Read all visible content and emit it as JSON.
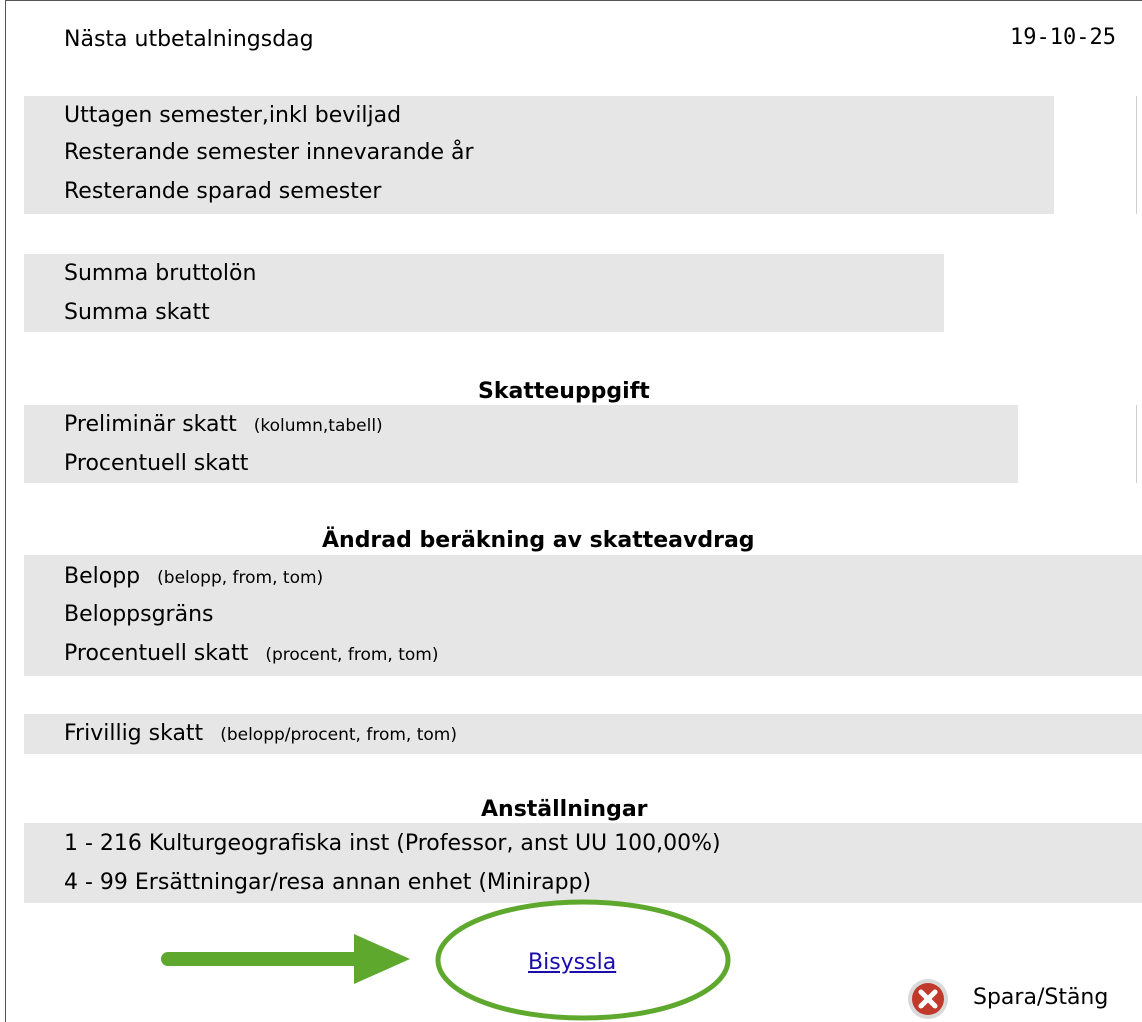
{
  "header": {
    "next_payday_label": "Nästa utbetalningsdag",
    "next_payday_value": "19-10-25"
  },
  "vacation": {
    "rows": [
      "Uttagen semester,inkl beviljad",
      "Resterande semester innevarande år",
      "Resterande sparad semester"
    ]
  },
  "totals": {
    "rows": [
      "Summa bruttolön",
      "Summa skatt"
    ]
  },
  "tax_info": {
    "title": "Skatteuppgift",
    "prelim_label": "Preliminär skatt",
    "prelim_hint": "(kolumn,tabell)",
    "percent_label": "Procentuell skatt"
  },
  "changed_calc": {
    "title": "Ändrad beräkning av skatteavdrag",
    "amount_label": "Belopp",
    "amount_hint": "(belopp, from, tom)",
    "limit_label": "Beloppsgräns",
    "percent_label": "Procentuell skatt",
    "percent_hint": "(procent, from, tom)"
  },
  "voluntary": {
    "label": "Frivillig skatt",
    "hint": "(belopp/procent, from, tom)"
  },
  "employments": {
    "title": "Anställningar",
    "rows": [
      "1 - 216 Kulturgeografiska inst (Professor, anst UU 100,00%)",
      "4 - 99 Ersättningar/resa annan enhet (Minirapp)"
    ]
  },
  "actions": {
    "side_job_link": "Bisyssla",
    "save_close_label": "Spara/Stäng",
    "close_icon": "close-circle-icon",
    "arrow_icon": "arrow-right-icon"
  },
  "colors": {
    "panel_bg": "#e6e6e6",
    "link": "#1a0dab",
    "annotation_green": "#5ea82e",
    "close_red": "#c0392b"
  }
}
